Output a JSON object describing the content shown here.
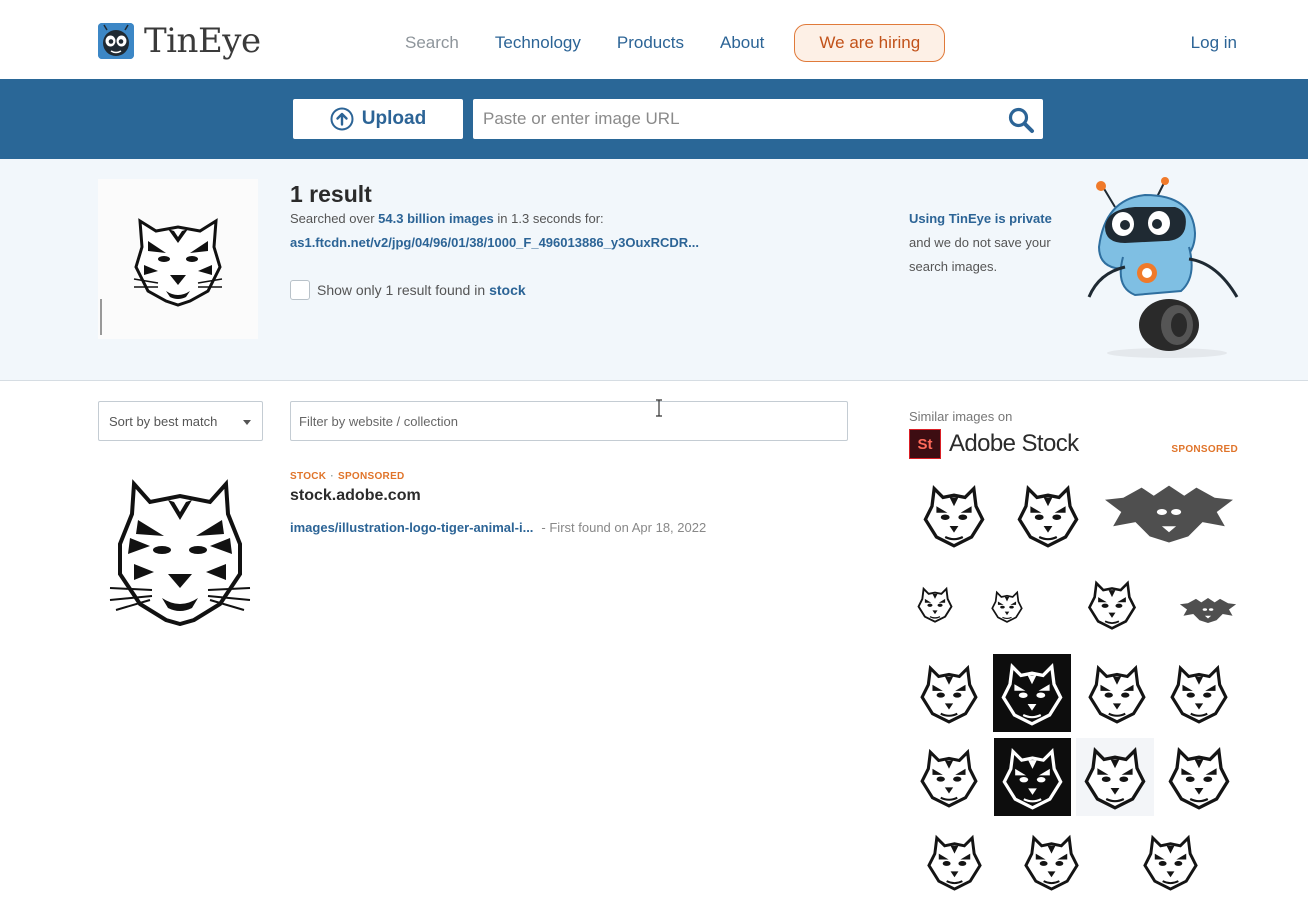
{
  "header": {
    "logo_text": "TinEye",
    "nav": [
      {
        "label": "Search",
        "active": true
      },
      {
        "label": "Technology",
        "active": false
      },
      {
        "label": "Products",
        "active": false
      },
      {
        "label": "About",
        "active": false
      }
    ],
    "hiring_label": "We are hiring",
    "login_label": "Log in"
  },
  "search": {
    "upload_label": "Upload",
    "url_placeholder": "Paste or enter image URL"
  },
  "summary": {
    "result_count": "1 result",
    "searched_prefix": "Searched over ",
    "image_count": "54.3 billion images",
    "searched_mid": " in ",
    "duration": "1.3",
    "searched_suffix": " seconds for:",
    "query_url": "as1.ftcdn.net/v2/jpg/04/96/01/38/1000_F_496013886_y3OuxRCDR...",
    "stock_filter_prefix": "Show only 1 result found in",
    "stock_filter_link": "stock",
    "privacy_link": "Using TinEye is private",
    "privacy_text": "and we do not save your search images."
  },
  "controls": {
    "sort_label": "Sort by best match",
    "filter_placeholder": "Filter by website / collection"
  },
  "results": [
    {
      "tag_stock": "STOCK",
      "tag_sponsored": "SPONSORED",
      "domain": "stock.adobe.com",
      "link": "images/illustration-logo-tiger-animal-i...",
      "first_found": "- First found on Apr 18, 2022"
    }
  ],
  "sidebar": {
    "similar_label": "Similar images on",
    "brand_badge": "St",
    "brand_name": "Adobe Stock",
    "sponsored_label": "SPONSORED",
    "gallery_icons": [
      "tiger-face-icon",
      "tiger-mask-icon",
      "winged-skull-icon",
      "tiger-head-icon",
      "wolf-head-icon",
      "roaring-panther-icon",
      "bat-icon",
      "dragon-head-icon",
      "panther-dark-icon",
      "tiger-logo-icon",
      "skull-icon",
      "tiger-roar-icon",
      "tiger-dark-icon",
      "tiger-photo-icon",
      "wolf-tribal-icon",
      "tiger-snarl-icon",
      "winged-skull-2-icon",
      "tribal-scorpion-icon"
    ]
  },
  "colors": {
    "link": "#2c6496",
    "band": "#2a6797",
    "accent": "#e0742a"
  }
}
